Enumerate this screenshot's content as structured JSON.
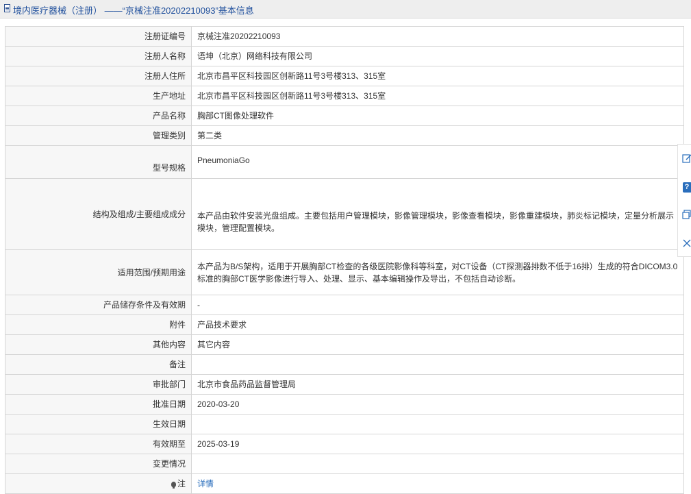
{
  "header": {
    "title": "境内医疗器械（注册） ——“京械注准20202210093”基本信息"
  },
  "rows": [
    {
      "label": "注册证编号",
      "value": "京械注准20202210093"
    },
    {
      "label": "注册人名称",
      "value": "语坤（北京）网络科技有限公司"
    },
    {
      "label": "注册人住所",
      "value": "北京市昌平区科技园区创新路11号3号楼313、315室"
    },
    {
      "label": "生产地址",
      "value": "北京市昌平区科技园区创新路11号3号楼313、315室"
    },
    {
      "label": "产品名称",
      "value": "胸部CT图像处理软件"
    },
    {
      "label": "管理类别",
      "value": "第二类"
    },
    {
      "label": "型号规格",
      "value": "PneumoniaGo"
    },
    {
      "label": "结构及组成/主要组成成分",
      "value": "本产品由软件安装光盘组成。主要包括用户管理模块，影像管理模块，影像查看模块，影像重建模块，肺炎标记模块，定量分析展示模块，管理配置模块。"
    },
    {
      "label": "适用范围/预期用途",
      "value": "本产品为B/S架构，适用于开展胸部CT检查的各级医院影像科等科室，对CT设备（CT探测器排数不低于16排）生成的符合DICOM3.0标准的胸部CT医学影像进行导入、处理、显示、基本编辑操作及导出，不包括自动诊断。"
    },
    {
      "label": "产品储存条件及有效期",
      "value": "-"
    },
    {
      "label": "附件",
      "value": "产品技术要求"
    },
    {
      "label": "其他内容",
      "value": "其它内容"
    },
    {
      "label": "备注",
      "value": ""
    },
    {
      "label": "审批部门",
      "value": "北京市食品药品监督管理局"
    },
    {
      "label": "批准日期",
      "value": "2020-03-20"
    },
    {
      "label": "生效日期",
      "value": ""
    },
    {
      "label": "有效期至",
      "value": "2025-03-19"
    },
    {
      "label": "变更情况",
      "value": ""
    },
    {
      "label": "注",
      "value": "详情"
    }
  ],
  "side_tools": {
    "t1": "edit-icon",
    "t2": "?",
    "t3": "copy-icon",
    "t4": "close-icon"
  },
  "colors": {
    "title": "#1f4f9c",
    "link": "#2a6ebc",
    "label_bg": "#f7f7f7",
    "border": "#d5d5d5"
  }
}
